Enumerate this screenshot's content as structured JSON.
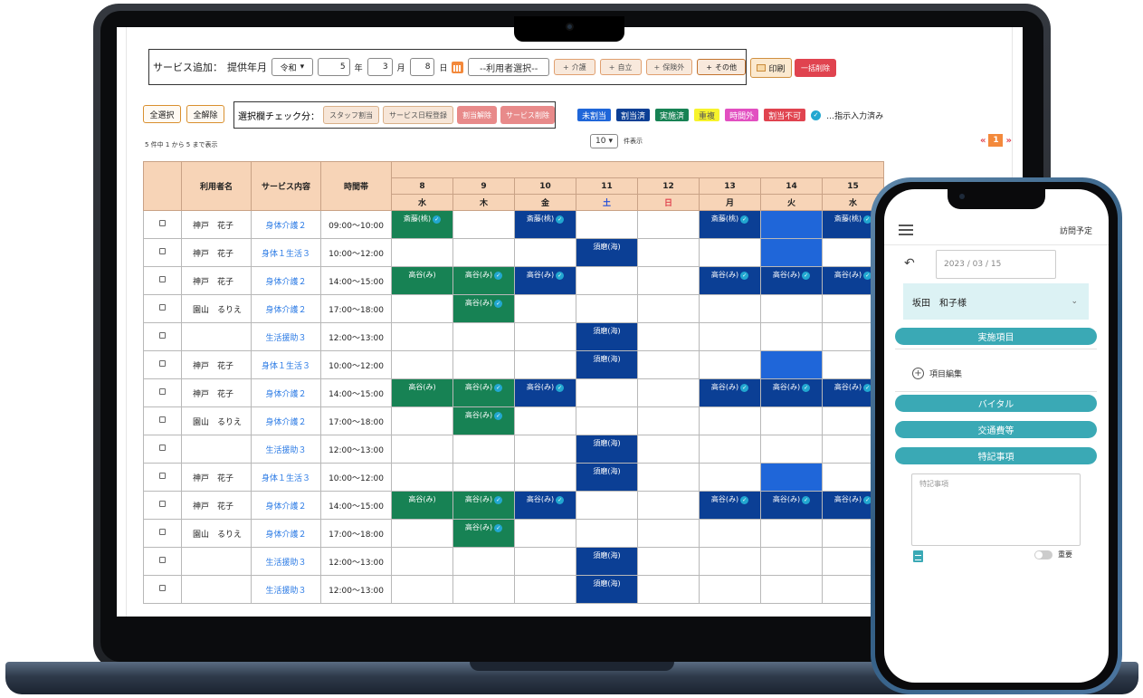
{
  "toolbar": {
    "add_label": "サービス追加：",
    "month_label": "提供年月",
    "era": "令和",
    "year": "5",
    "year_unit": "年",
    "month": "3",
    "month_unit": "月",
    "day": "8",
    "day_unit": "日",
    "user_select": "--利用者選択--",
    "add_buttons": [
      {
        "label": "介護"
      },
      {
        "label": "自立"
      },
      {
        "label": "保険外"
      },
      {
        "label": "その他"
      }
    ],
    "print_label": "印刷",
    "bulk_delete_label": "一括削除"
  },
  "selection": {
    "select_all": "全選択",
    "clear_all": "全解除",
    "check_label": "選択欄チェック分：",
    "buttons": [
      "スタッフ割当",
      "サービス日程登録",
      "割当解除",
      "サービス削除"
    ]
  },
  "legend": {
    "items": [
      {
        "label": "未割当",
        "color": "#1f66d9"
      },
      {
        "label": "割当済",
        "color": "#0b3f95"
      },
      {
        "label": "実施済",
        "color": "#178254"
      },
      {
        "label": "重複",
        "color": "#f7f32c"
      },
      {
        "label": "時間外",
        "color": "#e24fc1"
      },
      {
        "label": "割当不可",
        "color": "#e0434f"
      }
    ],
    "note": "…指示入力済み"
  },
  "listing": {
    "count_text": "5 件中 1 から 5 まで表示",
    "per_page": "10",
    "per_page_unit": "件表示",
    "page": "1",
    "prev": "«",
    "next": "»"
  },
  "grid": {
    "headers": {
      "user": "利用者名",
      "service": "サービス内容",
      "time": "時間帯"
    },
    "days": [
      {
        "date": "8",
        "dow": "水",
        "type": "weekday"
      },
      {
        "date": "9",
        "dow": "木",
        "type": "weekday"
      },
      {
        "date": "10",
        "dow": "金",
        "type": "weekday"
      },
      {
        "date": "11",
        "dow": "土",
        "type": "sat"
      },
      {
        "date": "12",
        "dow": "日",
        "type": "sun"
      },
      {
        "date": "13",
        "dow": "月",
        "type": "weekday"
      },
      {
        "date": "14",
        "dow": "火",
        "type": "weekday"
      },
      {
        "date": "15",
        "dow": "水",
        "type": "weekday"
      }
    ],
    "colors": {
      "g": "#178254",
      "b": "#0b3f95",
      "u": "#1f66d9"
    },
    "rows": [
      {
        "user": "神戸　花子",
        "service": "身体介護２",
        "time": "09:00〜10:00",
        "cells": [
          {
            "c": "g",
            "t": "斎藤(桃)",
            "ok": true
          },
          null,
          {
            "c": "b",
            "t": "斎藤(桃)",
            "ok": true
          },
          null,
          null,
          {
            "c": "b",
            "t": "斎藤(桃)",
            "ok": true
          },
          {
            "c": "u"
          },
          {
            "c": "b",
            "t": "斎藤(桃)",
            "ok": true
          }
        ]
      },
      {
        "user": "神戸　花子",
        "service": "身体１生活３",
        "time": "10:00〜12:00",
        "cells": [
          null,
          null,
          null,
          {
            "c": "b",
            "t": "須磨(海)"
          },
          null,
          null,
          {
            "c": "u"
          },
          null
        ]
      },
      {
        "user": "神戸　花子",
        "service": "身体介護２",
        "time": "14:00〜15:00",
        "cells": [
          {
            "c": "g",
            "t": "高谷(み)"
          },
          {
            "c": "g",
            "t": "高谷(み)",
            "ok": true
          },
          {
            "c": "b",
            "t": "高谷(み)",
            "ok": true
          },
          null,
          null,
          {
            "c": "b",
            "t": "高谷(み)",
            "ok": true
          },
          {
            "c": "b",
            "t": "高谷(み)",
            "ok": true
          },
          {
            "c": "b",
            "t": "高谷(み)",
            "ok": true
          }
        ]
      },
      {
        "user": "園山　るりえ",
        "service": "身体介護２",
        "time": "17:00〜18:00",
        "cells": [
          null,
          {
            "c": "g",
            "t": "高谷(み)",
            "ok": true
          },
          null,
          null,
          null,
          null,
          null,
          null
        ]
      },
      {
        "user": "",
        "service": "生活援助３",
        "time": "12:00〜13:00",
        "cells": [
          null,
          null,
          null,
          {
            "c": "b",
            "t": "須磨(海)"
          },
          null,
          null,
          null,
          null
        ]
      },
      {
        "user": "神戸　花子",
        "service": "身体１生活３",
        "time": "10:00〜12:00",
        "cells": [
          null,
          null,
          null,
          {
            "c": "b",
            "t": "須磨(海)"
          },
          null,
          null,
          {
            "c": "u"
          },
          null
        ]
      },
      {
        "user": "神戸　花子",
        "service": "身体介護２",
        "time": "14:00〜15:00",
        "cells": [
          {
            "c": "g",
            "t": "高谷(み)"
          },
          {
            "c": "g",
            "t": "高谷(み)",
            "ok": true
          },
          {
            "c": "b",
            "t": "高谷(み)",
            "ok": true
          },
          null,
          null,
          {
            "c": "b",
            "t": "高谷(み)",
            "ok": true
          },
          {
            "c": "b",
            "t": "高谷(み)",
            "ok": true
          },
          {
            "c": "b",
            "t": "高谷(み)",
            "ok": true
          }
        ]
      },
      {
        "user": "園山　るりえ",
        "service": "身体介護２",
        "time": "17:00〜18:00",
        "cells": [
          null,
          {
            "c": "g",
            "t": "高谷(み)",
            "ok": true
          },
          null,
          null,
          null,
          null,
          null,
          null
        ]
      },
      {
        "user": "",
        "service": "生活援助３",
        "time": "12:00〜13:00",
        "cells": [
          null,
          null,
          null,
          {
            "c": "b",
            "t": "須磨(海)"
          },
          null,
          null,
          null,
          null
        ]
      },
      {
        "user": "神戸　花子",
        "service": "身体１生活３",
        "time": "10:00〜12:00",
        "cells": [
          null,
          null,
          null,
          {
            "c": "b",
            "t": "須磨(海)"
          },
          null,
          null,
          {
            "c": "u"
          },
          null
        ]
      },
      {
        "user": "神戸　花子",
        "service": "身体介護２",
        "time": "14:00〜15:00",
        "cells": [
          {
            "c": "g",
            "t": "高谷(み)"
          },
          {
            "c": "g",
            "t": "高谷(み)",
            "ok": true
          },
          {
            "c": "b",
            "t": "高谷(み)",
            "ok": true
          },
          null,
          null,
          {
            "c": "b",
            "t": "高谷(み)",
            "ok": true
          },
          {
            "c": "b",
            "t": "高谷(み)",
            "ok": true
          },
          {
            "c": "b",
            "t": "高谷(み)",
            "ok": true
          }
        ]
      },
      {
        "user": "園山　るりえ",
        "service": "身体介護２",
        "time": "17:00〜18:00",
        "cells": [
          null,
          {
            "c": "g",
            "t": "高谷(み)",
            "ok": true
          },
          null,
          null,
          null,
          null,
          null,
          null
        ]
      },
      {
        "user": "",
        "service": "生活援助３",
        "time": "12:00〜13:00",
        "cells": [
          null,
          null,
          null,
          {
            "c": "b",
            "t": "須磨(海)"
          },
          null,
          null,
          null,
          null
        ]
      },
      {
        "user": "",
        "service": "生活援助３",
        "time": "12:00〜13:00",
        "cells": [
          null,
          null,
          null,
          {
            "c": "b",
            "t": "須磨(海)"
          },
          null,
          null,
          null,
          null
        ]
      }
    ]
  },
  "phone": {
    "title": "訪問予定",
    "date": "2023 / 03 / 15",
    "person": "坂田　和子様",
    "section_items": "実施項目",
    "edit_items": "項目編集",
    "vital": "バイタル",
    "transport": "交通費等",
    "special": "特記事項",
    "memo_placeholder": "特記事項",
    "important": "重要"
  }
}
